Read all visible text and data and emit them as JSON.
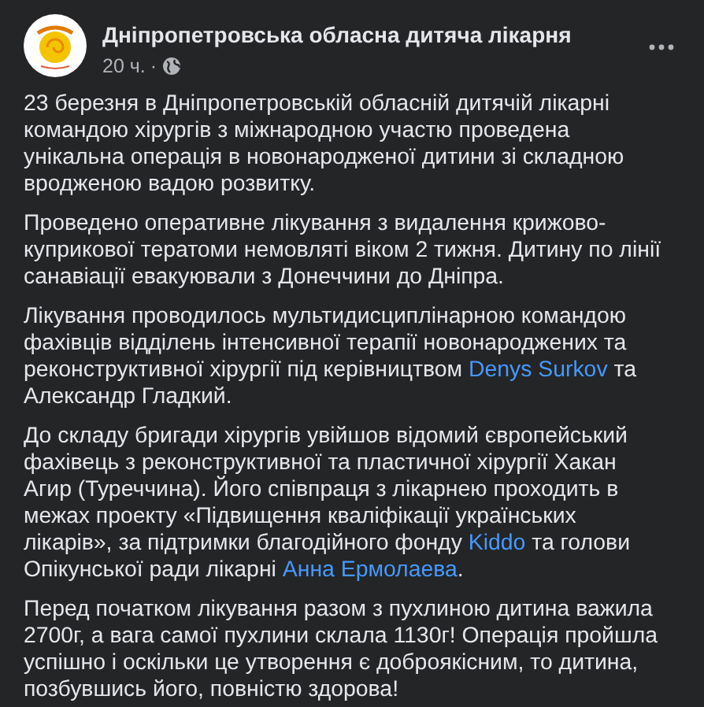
{
  "post": {
    "author": "Дніпропетровська обласна дитяча лікарня",
    "time": "20 ч.",
    "separator": "·",
    "paragraphs": [
      [
        {
          "kind": "text",
          "text": "23 березня в Дніпропетровській обласній дитячій лікарні командою хірургів з міжнародною участю проведена унікальна операція в новонародженої дитини зі складною вродженою вадою розвитку."
        }
      ],
      [
        {
          "kind": "text",
          "text": "Проведено оперативне лікування з видалення крижово-куприкової тератоми немовляті віком 2 тижня. Дитину по лінії санавіації евакуювали з Донеччини до Дніпра."
        }
      ],
      [
        {
          "kind": "text",
          "text": "Лікування проводилось мультидисциплінарною командою фахівців відділень інтенсивної терапії новонароджених та реконструктивної хірургії під керівництвом "
        },
        {
          "kind": "link",
          "text": "Denys Surkov"
        },
        {
          "kind": "text",
          "text": " та Александр Гладкий."
        }
      ],
      [
        {
          "kind": "text",
          "text": "До складу бригади хірургів увійшов відомий європейський фахівець з реконструктивної та пластичної хірургії Хакан Агир (Туреччина). Його співпраця з лікарнею проходить в межах проекту «Підвищення кваліфікації українських лікарів», за підтримки благодійного фонду "
        },
        {
          "kind": "link",
          "text": "Kiddo"
        },
        {
          "kind": "text",
          "text": " та голови Опікунської ради лікарні "
        },
        {
          "kind": "link",
          "text": "Анна Ермолаева"
        },
        {
          "kind": "text",
          "text": "."
        }
      ],
      [
        {
          "kind": "text",
          "text": "Перед початком лікування разом з пухлиною дитина важила 2700г, а вага самої пухлини склала 1130г! Операція пройшла успішно і оскільки це утворення є доброякісним, то дитина, позбувшись його, повністю здорова!"
        }
      ]
    ]
  }
}
